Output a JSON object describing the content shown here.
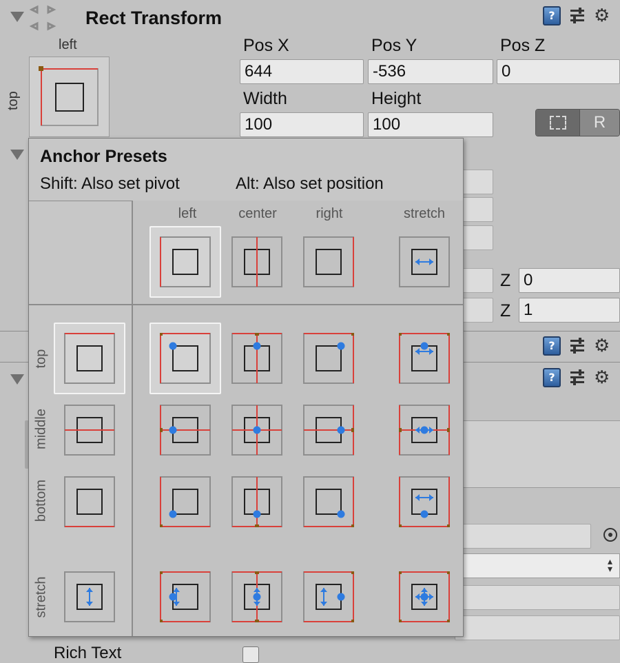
{
  "component": {
    "title": "Rect Transform",
    "anchor_widget": {
      "horizontal_label": "left",
      "vertical_label": "top"
    },
    "fields": {
      "pos_x": {
        "label": "Pos X",
        "value": "644"
      },
      "pos_y": {
        "label": "Pos Y",
        "value": "-536"
      },
      "pos_z": {
        "label": "Pos Z",
        "value": "0"
      },
      "width": {
        "label": "Width",
        "value": "100"
      },
      "height": {
        "label": "Height",
        "value": "100"
      }
    },
    "buttons": {
      "blueprint_icon": "dashed-rect-icon",
      "raw_label": "R"
    }
  },
  "background_rows": [
    {
      "label": "Z",
      "value": "0"
    },
    {
      "label": "Z",
      "value": "1"
    }
  ],
  "peek_text": "Rich Text",
  "anchor_presets": {
    "title": "Anchor Presets",
    "hint_shift": "Shift: Also set pivot",
    "hint_alt": "Alt: Also set position",
    "columns": [
      "left",
      "center",
      "right",
      "stretch"
    ],
    "rows": [
      "top",
      "middle",
      "bottom",
      "stretch"
    ],
    "selected": {
      "row": "top",
      "column": "left"
    }
  },
  "colors": {
    "anchor_line": "#d9403a",
    "pivot_dot": "#2e7be0",
    "corner_marker": "#8a5a12",
    "selection_border": "#f4f4f4"
  }
}
